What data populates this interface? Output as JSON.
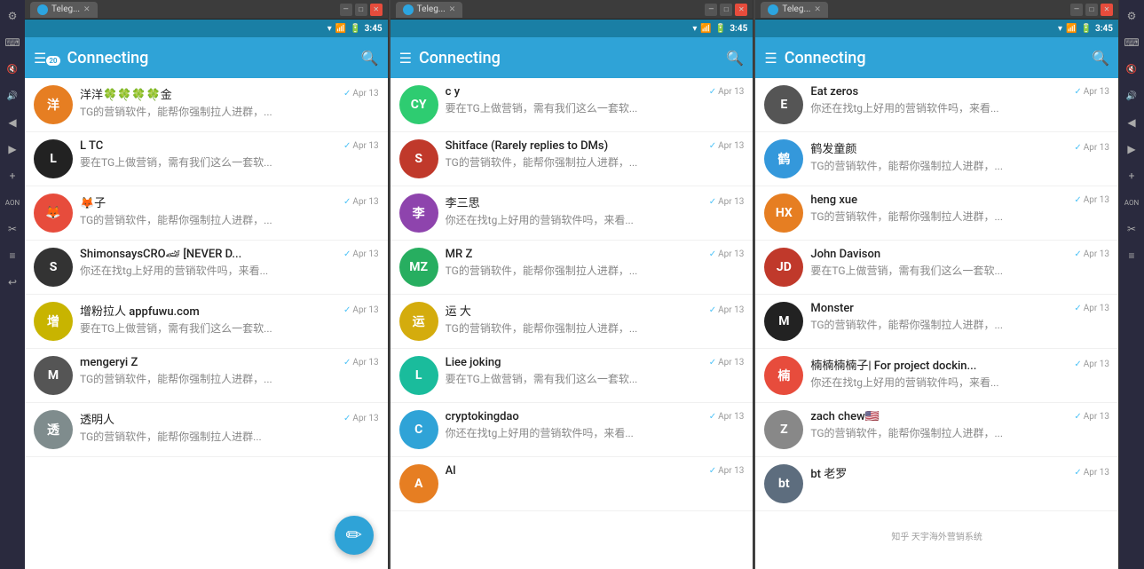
{
  "panels": [
    {
      "id": "panel1",
      "tab_label": "Teleg...",
      "header_title": "Connecting",
      "badge": "20",
      "time": "3:45",
      "chats": [
        {
          "name": "洋洋🍀🍀🍀🍀金",
          "msg": "TG的营销软件，能帮你强制拉人进群，...",
          "time": "Apr 13",
          "avatar_color": "#e67e22",
          "avatar_text": "洋",
          "avatar_emoji": "🍀"
        },
        {
          "name": "L TC",
          "msg": "要在TG上做营销，需有我们这么一套软...",
          "time": "Apr 13",
          "avatar_color": "#222",
          "avatar_text": "L"
        },
        {
          "name": "🦊子",
          "msg": "TG的营销软件，能帮你强制拉人进群，...",
          "time": "Apr 13",
          "avatar_color": "#e74c3c",
          "avatar_text": "🦊"
        },
        {
          "name": "ShimonsaysCRO🏎 [NEVER D...",
          "msg": "你还在找tg上好用的营销软件吗，来看...",
          "time": "Apr 13",
          "avatar_color": "#333",
          "avatar_text": "S"
        },
        {
          "name": "增粉拉人 appfuwu.com",
          "msg": "要在TG上做营销，需有我们这么一套软...",
          "time": "Apr 13",
          "avatar_color": "#c8b400",
          "avatar_text": "增"
        },
        {
          "name": "mengeryi Z",
          "msg": "TG的营销软件，能帮你强制拉人进群，...",
          "time": "Apr 13",
          "avatar_color": "#555",
          "avatar_text": "M"
        },
        {
          "name": "透明人",
          "msg": "TG的营销软件，能帮你强制拉人进群...",
          "time": "Apr 13",
          "avatar_color": "#7f8c8d",
          "avatar_text": "透"
        }
      ]
    },
    {
      "id": "panel2",
      "tab_label": "Teleg...",
      "header_title": "Connecting",
      "badge": "",
      "time": "3:45",
      "chats": [
        {
          "name": "c y",
          "msg": "要在TG上做营销，需有我们这么一套软...",
          "time": "Apr 13",
          "avatar_color": "#2ecc71",
          "avatar_text": "CY"
        },
        {
          "name": "Shitface (Rarely replies to DMs)",
          "msg": "TG的营销软件，能帮你强制拉人进群，...",
          "time": "Apr 13",
          "avatar_color": "#c0392b",
          "avatar_text": "S",
          "has_img": true,
          "img_bg": "#c0392b"
        },
        {
          "name": "李三思",
          "msg": "你还在找tg上好用的营销软件吗，来看...",
          "time": "Apr 13",
          "avatar_color": "#8e44ad",
          "avatar_text": "李"
        },
        {
          "name": "MR Z",
          "msg": "TG的营销软件，能帮你强制拉人进群，...",
          "time": "Apr 13",
          "avatar_color": "#27ae60",
          "avatar_text": "MZ"
        },
        {
          "name": "运 大",
          "msg": "TG的营销软件，能帮你强制拉人进群，...",
          "time": "Apr 13",
          "avatar_color": "#d4ac0d",
          "avatar_text": "运"
        },
        {
          "name": "Liee joking",
          "msg": "要在TG上做营销，需有我们这么一套软...",
          "time": "Apr 13",
          "avatar_color": "#1abc9c",
          "avatar_text": "L"
        },
        {
          "name": "cryptokingdao",
          "msg": "你还在找tg上好用的营销软件吗，来看...",
          "time": "Apr 13",
          "avatar_color": "#2fa3d7",
          "avatar_text": "C"
        },
        {
          "name": "Al",
          "msg": "",
          "time": "Apr 13",
          "avatar_color": "#e67e22",
          "avatar_text": "A"
        }
      ]
    },
    {
      "id": "panel3",
      "tab_label": "Teleg...",
      "header_title": "Connecting",
      "badge": "",
      "time": "3:45",
      "chats": [
        {
          "name": "Eat zeros",
          "msg": "你还在找tg上好用的营销软件吗，来看...",
          "time": "Apr 13",
          "avatar_color": "#555",
          "avatar_text": "E"
        },
        {
          "name": "鹤发童颜",
          "msg": "TG的营销软件，能帮你强制拉人进群，...",
          "time": "Apr 13",
          "avatar_color": "#3498db",
          "avatar_text": "鹤"
        },
        {
          "name": "heng xue",
          "msg": "TG的营销软件，能帮你强制拉人进群，...",
          "time": "Apr 13",
          "avatar_color": "#e67e22",
          "avatar_text": "HX"
        },
        {
          "name": "John Davison",
          "msg": "要在TG上做营销，需有我们这么一套软...",
          "time": "Apr 13",
          "avatar_color": "#c0392b",
          "avatar_text": "JD"
        },
        {
          "name": "Monster",
          "msg": "TG的营销软件，能帮你强制拉人进群，...",
          "time": "Apr 13",
          "avatar_color": "#222",
          "avatar_text": "M"
        },
        {
          "name": "楠楠楠楠子| For project dockin...",
          "msg": "你还在找tg上好用的营销软件吗，来看...",
          "time": "Apr 13",
          "avatar_color": "#e74c3c",
          "avatar_text": "楠"
        },
        {
          "name": "zach chew🇺🇸",
          "msg": "TG的营销软件，能帮你强制拉人进群，...",
          "time": "Apr 13",
          "avatar_color": "#888",
          "avatar_text": "Z"
        },
        {
          "name": "bt 老罗",
          "msg": "",
          "time": "Apr 13",
          "avatar_color": "#5d6d7e",
          "avatar_text": "bt"
        }
      ]
    }
  ],
  "toolbar_icons": [
    "≡",
    "⌨",
    "🔇",
    "🔇",
    "◀",
    "▶",
    "+",
    "AON",
    "✂",
    "≡",
    "↩"
  ],
  "right_toolbar_icons": [
    "⚙",
    "⌨",
    "🔇",
    "🔊",
    "◀",
    "▶",
    "+",
    "AON",
    "✂",
    "≡"
  ],
  "watermark": "知乎 天宇海外营销系统"
}
